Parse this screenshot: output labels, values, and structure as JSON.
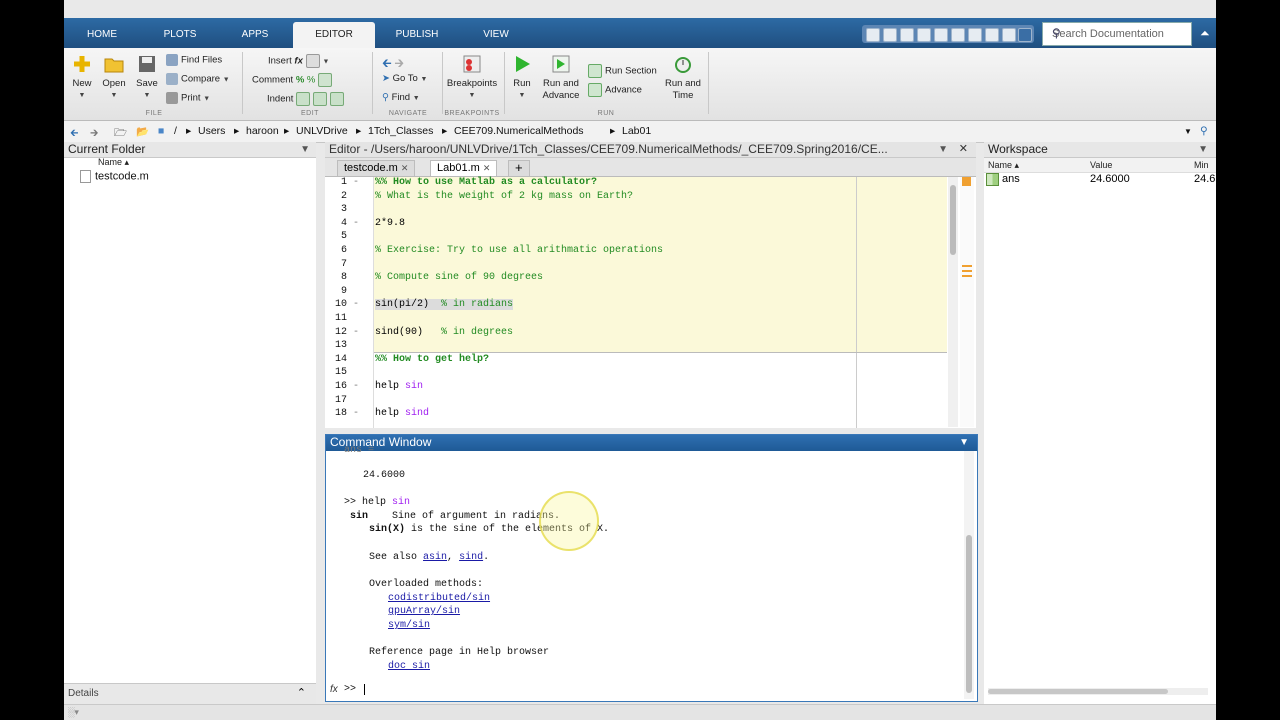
{
  "tabs": [
    "HOME",
    "PLOTS",
    "APPS",
    "EDITOR",
    "PUBLISH",
    "VIEW"
  ],
  "search": {
    "placeholder": "Search Documentation"
  },
  "ribbon": {
    "new": "New",
    "open": "Open",
    "save": "Save",
    "find_files": "Find Files",
    "compare": "Compare",
    "print": "Print",
    "insert": "Insert",
    "comment": "Comment",
    "indent": "Indent",
    "goto": "Go To",
    "find": "Find",
    "breakpoints": "Breakpoints",
    "run": "Run",
    "run_advance": "Run and Advance",
    "run_section": "Run Section",
    "advance": "Advance",
    "run_time": "Run and Time",
    "groups": {
      "file": "FILE",
      "edit": "EDIT",
      "navigate": "NAVIGATE",
      "breakpoints": "BREAKPOINTS",
      "run": "RUN"
    }
  },
  "address": {
    "path": [
      "/",
      "Users",
      "haroon",
      "UNLVDrive",
      "1Tch_Classes",
      "CEE709.NumericalMethods",
      "Lab01"
    ]
  },
  "current_folder": {
    "title": "Current Folder",
    "col_name": "Name ▴",
    "files": [
      "testcode.m"
    ],
    "details": "Details"
  },
  "editor": {
    "title": "Editor - /Users/haroon/UNLVDrive/1Tch_Classes/CEE709.NumericalMethods/_CEE709.Spring2016/CE...",
    "tabs": [
      "testcode.m",
      "Lab01.m"
    ],
    "lines": [
      {
        "n": "1",
        "text": "%% How to use Matlab as a calculator?"
      },
      {
        "n": "2",
        "text": "% What is the weight of 2 kg mass on Earth?"
      },
      {
        "n": "3",
        "text": ""
      },
      {
        "n": "4",
        "text": "2*9.8"
      },
      {
        "n": "5",
        "text": ""
      },
      {
        "n": "6",
        "text": "% Exercise: Try to use all arithmatic operations"
      },
      {
        "n": "7",
        "text": ""
      },
      {
        "n": "8",
        "text": "% Compute sine of 90 degrees"
      },
      {
        "n": "9",
        "text": ""
      },
      {
        "n": "10",
        "code": "sin(pi/2)",
        "comment": "% in radians"
      },
      {
        "n": "11",
        "text": ""
      },
      {
        "n": "12",
        "code": "sind(90)",
        "comment": "% in degrees"
      },
      {
        "n": "13",
        "text": ""
      },
      {
        "n": "14",
        "text": "%% How to get help?"
      },
      {
        "n": "15",
        "text": ""
      },
      {
        "n": "16",
        "code": "help",
        "arg": "sin"
      },
      {
        "n": "17",
        "text": ""
      },
      {
        "n": "18",
        "code": "help",
        "arg": "sind"
      }
    ]
  },
  "command_window": {
    "title": "Command Window",
    "ans_partial": "ans =",
    "value": "24.6000",
    "prompt_cmd": ">> help",
    "prompt_arg": "sin",
    "fn_name": "sin",
    "fn_desc": "Sine of argument in radians.",
    "fn_sig": "sin(X)",
    "fn_sig_rest": " is the sine of the elements of X.",
    "see_also": "See also",
    "see_links": [
      "asin",
      "sind"
    ],
    "overloaded": "Overloaded methods:",
    "overloads": [
      "codistributed/sin",
      "gpuArray/sin",
      "sym/sin"
    ],
    "reference": "Reference page in Help browser",
    "doc_link": "doc sin",
    "fx": "fx",
    "prompt": ">>"
  },
  "workspace": {
    "title": "Workspace",
    "cols": [
      "Name ▴",
      "Value",
      "Min"
    ],
    "rows": [
      {
        "name": "ans",
        "value": "24.6000",
        "min": "24.6"
      }
    ]
  }
}
